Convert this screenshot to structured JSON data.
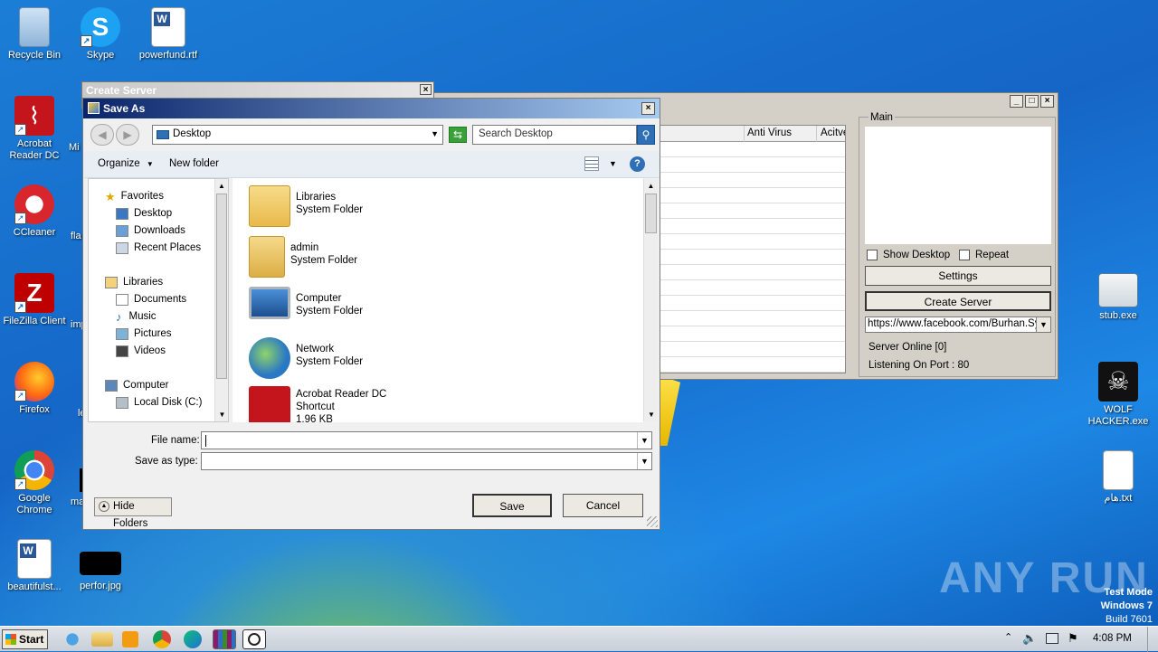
{
  "desktop": {
    "icons_left": [
      {
        "name": "recycle-bin-icon",
        "label": "Recycle Bin"
      },
      {
        "name": "skype-icon",
        "label": "Skype"
      },
      {
        "name": "word-doc-icon",
        "label": "powerfund.rtf"
      },
      {
        "name": "acrobat-icon",
        "label": "Acrobat Reader DC"
      },
      {
        "name": "ccleaner-icon",
        "label": "CCleaner"
      },
      {
        "name": "filezilla-icon",
        "label": "FileZilla Client"
      },
      {
        "name": "firefox-icon",
        "label": "Firefox"
      },
      {
        "name": "chrome-icon",
        "label": "Google Chrome"
      },
      {
        "name": "word-doc-icon",
        "label": "beautifulst..."
      },
      {
        "name": "image-file-icon",
        "label": "perfor.jpg"
      }
    ],
    "partial_labels": [
      "Mi",
      "fla",
      "imp",
      "le",
      "ma"
    ],
    "icons_right": [
      {
        "name": "exe-icon",
        "label": "stub.exe"
      },
      {
        "name": "skull-icon",
        "label": "WOLF HACKER.exe"
      },
      {
        "name": "text-file-icon",
        "label": "هام.txt"
      }
    ],
    "watermark": "ANY RUN",
    "test_mode": {
      "line1": "Test Mode",
      "line2": "Windows 7",
      "line3": "Build 7601"
    }
  },
  "rat_window": {
    "columns": [
      "Anti Virus",
      "Acitve"
    ],
    "main_group": "Main",
    "show_desktop": "Show Desktop",
    "repeat": "Repeat",
    "settings_btn": "Settings",
    "create_server_btn": "Create Server",
    "url_value": "https://www.facebook.com/Burhan.Sy",
    "server_online": "Server Online [0]",
    "listening": "Listening On Port : 80"
  },
  "create_server_window": {
    "title": "Create Server"
  },
  "save_as": {
    "title": "Save As",
    "location": "Desktop",
    "search_placeholder": "Search Desktop",
    "organize": "Organize",
    "new_folder": "New folder",
    "tree": {
      "favorites": "Favorites",
      "desktop": "Desktop",
      "downloads": "Downloads",
      "recent": "Recent Places",
      "libraries": "Libraries",
      "documents": "Documents",
      "music": "Music",
      "pictures": "Pictures",
      "videos": "Videos",
      "computer": "Computer",
      "local_disk": "Local Disk (C:)"
    },
    "files": [
      {
        "name": "Libraries",
        "type": "System Folder"
      },
      {
        "name": "admin",
        "type": "System Folder"
      },
      {
        "name": "Computer",
        "type": "System Folder"
      },
      {
        "name": "Network",
        "type": "System Folder"
      },
      {
        "name": "Acrobat Reader DC",
        "type": "Shortcut",
        "size": "1.96 KB"
      }
    ],
    "file_name_label": "File name:",
    "file_name_value": "",
    "save_type_label": "Save as type:",
    "save_type_value": "",
    "hide_folders": "Hide Folders",
    "save_btn": "Save",
    "cancel_btn": "Cancel"
  },
  "taskbar": {
    "start": "Start",
    "time": "4:08 PM"
  }
}
